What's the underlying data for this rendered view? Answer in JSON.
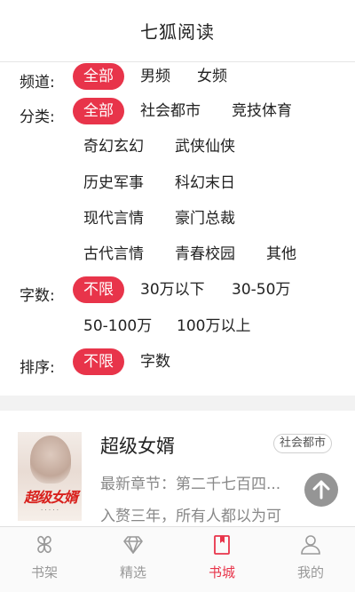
{
  "header": {
    "title": "七狐阅读"
  },
  "filters": {
    "channel": {
      "label": "频道:",
      "options": [
        "全部",
        "男频",
        "女频"
      ],
      "selected": "全部"
    },
    "category": {
      "label": "分类:",
      "options": [
        "全部",
        "社会都市",
        "竞技体育",
        "奇幻玄幻",
        "武侠仙侠",
        "历史军事",
        "科幻末日",
        "现代言情",
        "豪门总裁",
        "古代言情",
        "青春校园",
        "其他"
      ],
      "selected": "全部"
    },
    "word_count": {
      "label": "字数:",
      "options": [
        "不限",
        "30万以下",
        "30-50万",
        "50-100万",
        "100万以上"
      ],
      "selected": "不限"
    },
    "sort": {
      "label": "排序:",
      "options": [
        "不限",
        "字数"
      ],
      "selected": "不限"
    }
  },
  "book": {
    "title": "超级女婿",
    "tag": "社会都市",
    "cover_title": "超级女婿",
    "latest_chapter": "最新章节：第二千七百四...",
    "description": "入赘三年，所有人都以为可"
  },
  "tabbar": {
    "items": [
      {
        "label": "书架",
        "icon": "bookshelf-icon"
      },
      {
        "label": "精选",
        "icon": "diamond-icon"
      },
      {
        "label": "书城",
        "icon": "bookstore-icon"
      },
      {
        "label": "我的",
        "icon": "profile-icon"
      }
    ],
    "active": "书城"
  },
  "colors": {
    "accent": "#e8344a",
    "muted": "#999999"
  }
}
